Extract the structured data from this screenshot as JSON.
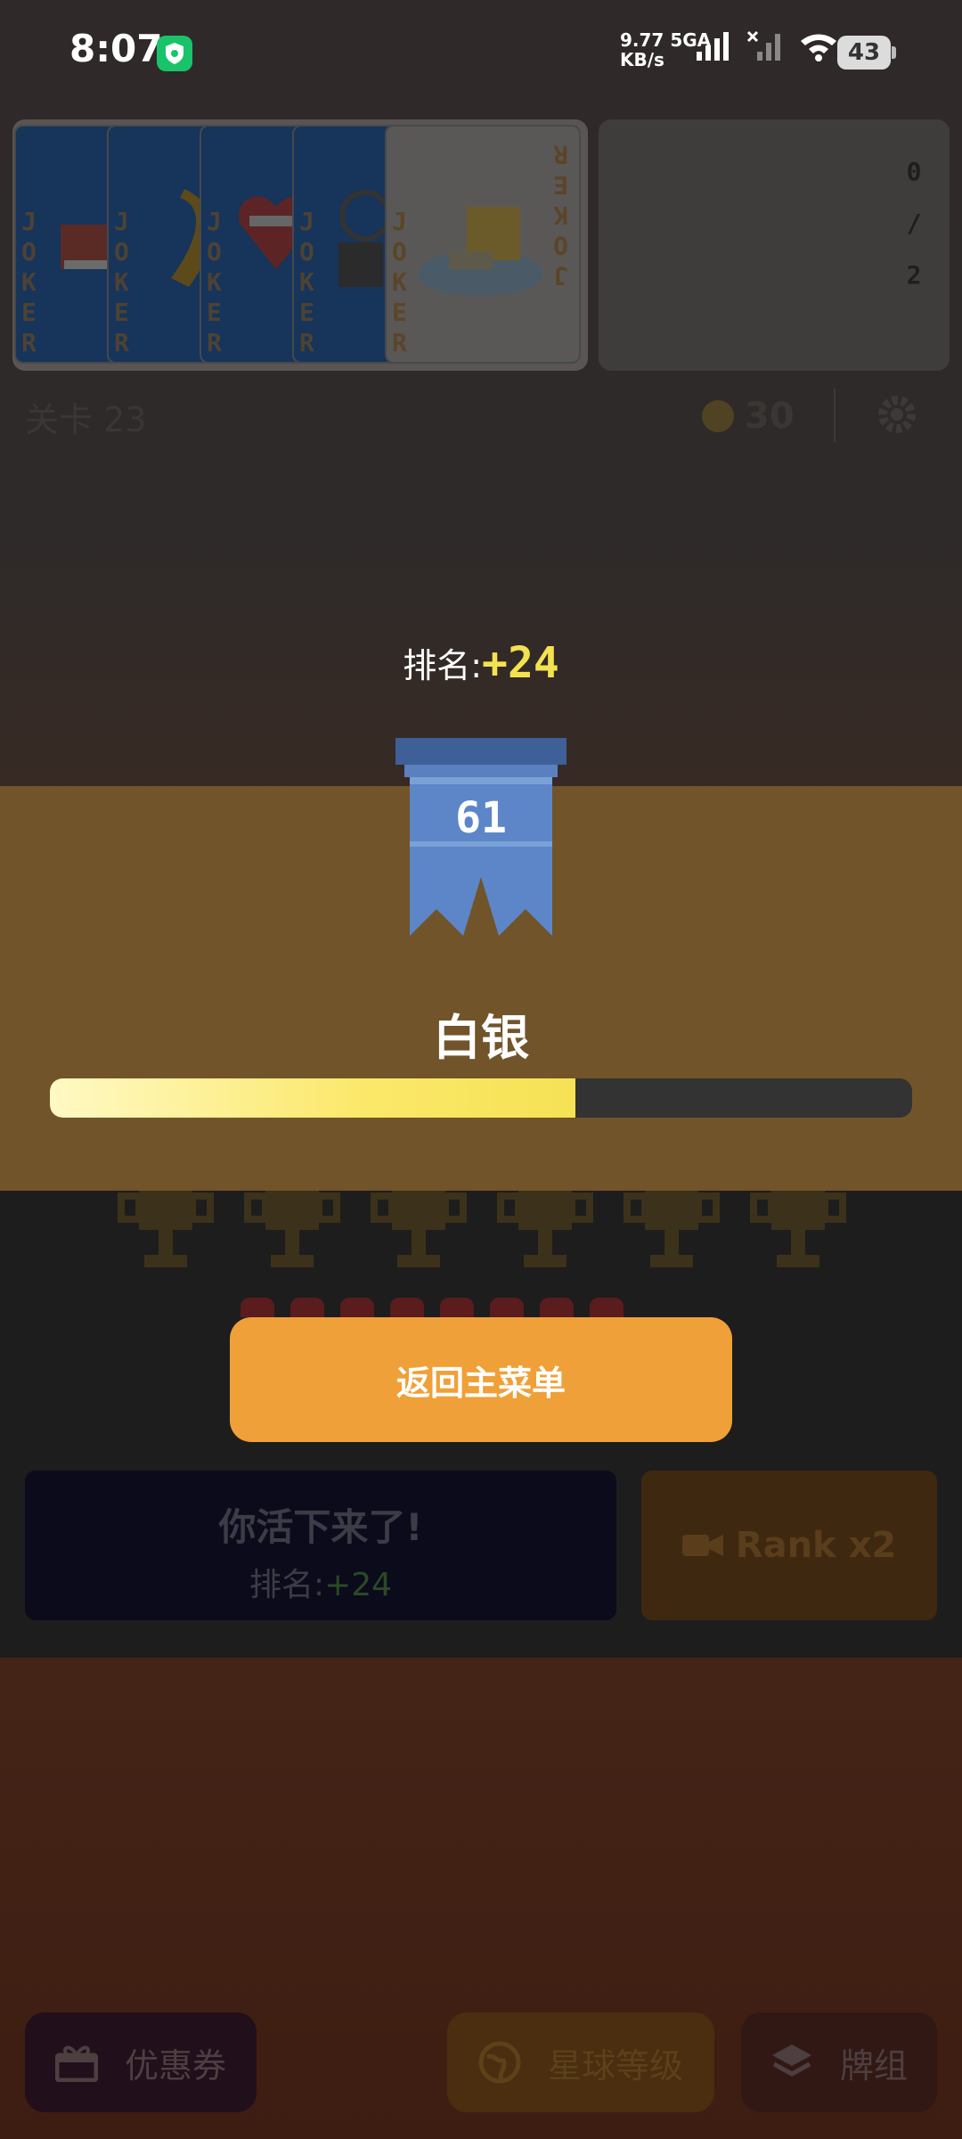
{
  "status_bar": {
    "time": "8:07",
    "net_speed_value": "9.77",
    "net_speed_unit": "KB/s",
    "network_type": "5GA",
    "battery": "43"
  },
  "top": {
    "card_letters": "JOKER",
    "tray_count": "0/2",
    "level_label": "关卡 23",
    "coins": "30"
  },
  "modal": {
    "rank_label": "排名:",
    "rank_plus": "+24",
    "badge_number": "61",
    "tier": "白银",
    "progress": 0.61,
    "return_button": "返回主菜单"
  },
  "result": {
    "survived": "你活下来了!",
    "rank_label": "排名:",
    "rank_plus": "+24",
    "rank_x2": "Rank x2"
  },
  "bottom_nav": {
    "coupon": "优惠券",
    "planet_level": "星球等级",
    "deck": "牌组"
  },
  "colors": {
    "accent_orange": "#f0a038",
    "rank_yellow": "#f3e24f",
    "band_brown": "#72542a"
  }
}
